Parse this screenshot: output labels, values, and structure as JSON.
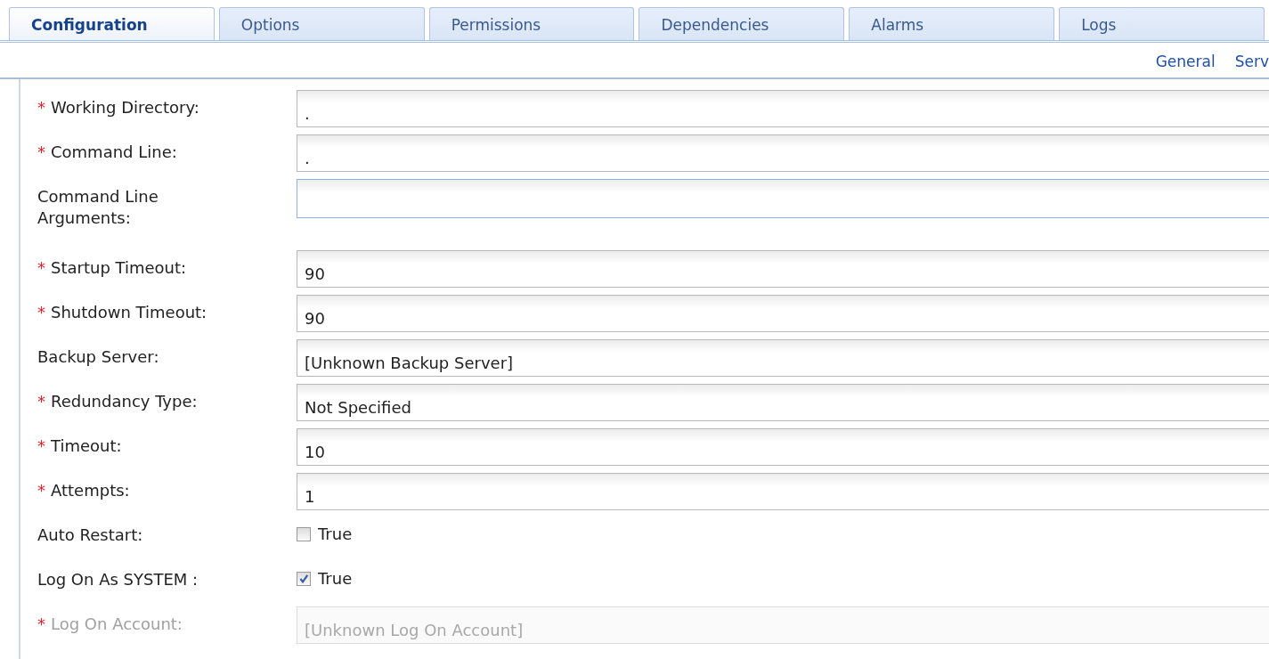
{
  "tabs": [
    {
      "label": "Configuration",
      "selected": true
    },
    {
      "label": "Options",
      "selected": false
    },
    {
      "label": "Permissions",
      "selected": false
    },
    {
      "label": "Dependencies",
      "selected": false
    },
    {
      "label": "Alarms",
      "selected": false
    },
    {
      "label": "Logs",
      "selected": false
    }
  ],
  "section_links": [
    "General",
    "Serv"
  ],
  "fields": [
    {
      "kind": "text",
      "label": "Working Directory:",
      "marker": "*",
      "value": ".",
      "focused": false,
      "disabled": false
    },
    {
      "kind": "text",
      "label": "Command Line:",
      "marker": "*",
      "value": ".",
      "focused": false,
      "disabled": false
    },
    {
      "kind": "text",
      "label": "Command Line Arguments:",
      "focused": true,
      "disabled": false
    },
    {
      "kind": "text",
      "label": "Startup Timeout:",
      "marker": "*",
      "value": "90",
      "focused": false,
      "disabled": false
    },
    {
      "kind": "text",
      "label": "Shutdown Timeout:",
      "marker": "*",
      "value": "90",
      "focused": false,
      "disabled": false
    },
    {
      "kind": "text",
      "label": "Backup Server:",
      "value": "[Unknown Backup Server]",
      "focused": false,
      "disabled": false
    },
    {
      "kind": "text",
      "label": "Redundancy Type:",
      "marker": "*",
      "value": "Not Specified",
      "focused": false,
      "disabled": false
    },
    {
      "kind": "text",
      "label": "Timeout:",
      "marker": "*",
      "value": "10",
      "focused": false,
      "disabled": false
    },
    {
      "kind": "text",
      "label": "Attempts:",
      "marker": "*",
      "value": "1",
      "focused": false,
      "disabled": false
    },
    {
      "kind": "checkbox",
      "label": "Auto Restart:",
      "checked": false,
      "option": "True"
    },
    {
      "kind": "checkbox",
      "label": "Log On As SYSTEM :",
      "checked": true,
      "option": "True"
    },
    {
      "kind": "text",
      "label": "Log On Account:",
      "marker": "*",
      "value": "[Unknown Log On Account]",
      "focused": false,
      "disabled": true
    }
  ]
}
